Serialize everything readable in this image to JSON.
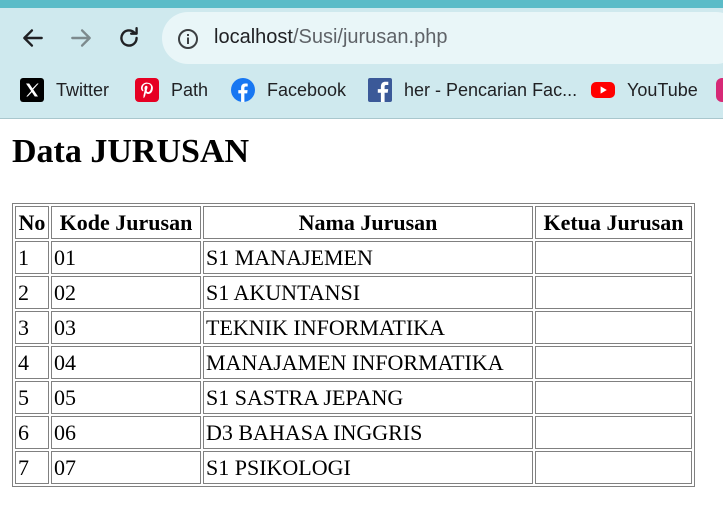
{
  "browser": {
    "url_host": "localhost",
    "url_path": "/Susi/jurusan.php",
    "bookmarks": [
      {
        "label": "Twitter",
        "icon": "x-twitter-icon"
      },
      {
        "label": "Path",
        "icon": "pinterest-icon"
      },
      {
        "label": "Facebook",
        "icon": "facebook-icon"
      },
      {
        "label": "her - Pencarian Fac...",
        "icon": "facebook-square-icon"
      },
      {
        "label": "YouTube",
        "icon": "youtube-icon"
      }
    ]
  },
  "page": {
    "title": "Data JURUSAN"
  },
  "table": {
    "headers": [
      "No",
      "Kode Jurusan",
      "Nama Jurusan",
      "Ketua Jurusan"
    ],
    "rows": [
      [
        "1",
        "01",
        "S1 MANAJEMEN",
        ""
      ],
      [
        "2",
        "02",
        "S1 AKUNTANSI",
        ""
      ],
      [
        "3",
        "03",
        "TEKNIK INFORMATIKA",
        ""
      ],
      [
        "4",
        "04",
        "MANAJAMEN INFORMATIKA",
        ""
      ],
      [
        "5",
        "05",
        "S1 SASTRA JEPANG",
        ""
      ],
      [
        "6",
        "06",
        "D3 BAHASA INGGRIS",
        ""
      ],
      [
        "7",
        "07",
        "S1 PSIKOLOGI",
        ""
      ]
    ]
  },
  "colors": {
    "toolbar": "#cfe9ee",
    "address_bar": "#e9f6f8",
    "accent_top": "#5bbcc8",
    "pinterest": "#e60023",
    "facebook": "#1877f2",
    "facebook_square": "#3b5998",
    "youtube": "#ff0000"
  }
}
